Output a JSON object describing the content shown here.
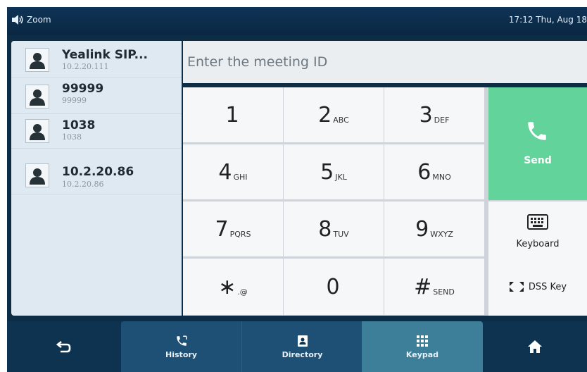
{
  "status_bar": {
    "mode_label": "Zoom",
    "datetime": "17:12 Thu, Aug 18"
  },
  "contacts": [
    {
      "name": "Yealink SIP...",
      "number": "10.2.20.111"
    },
    {
      "name": "99999",
      "number": "99999"
    },
    {
      "name": "1038",
      "number": "1038"
    },
    {
      "name": "10.2.20.86",
      "number": "10.2.20.86"
    }
  ],
  "meeting_input": {
    "placeholder": "Enter the meeting ID",
    "value": ""
  },
  "keypad": [
    {
      "digit": "1",
      "sub": ""
    },
    {
      "digit": "2",
      "sub": "ABC"
    },
    {
      "digit": "3",
      "sub": "DEF"
    },
    {
      "digit": "4",
      "sub": "GHI"
    },
    {
      "digit": "5",
      "sub": "JKL"
    },
    {
      "digit": "6",
      "sub": "MNO"
    },
    {
      "digit": "7",
      "sub": "PQRS"
    },
    {
      "digit": "8",
      "sub": "TUV"
    },
    {
      "digit": "9",
      "sub": "WXYZ"
    },
    {
      "digit": "∗",
      "sub": ".@"
    },
    {
      "digit": "0",
      "sub": ""
    },
    {
      "digit": "#",
      "sub": "SEND"
    }
  ],
  "actions": {
    "send_label": "Send",
    "keyboard_label": "Keyboard",
    "dss_label": "DSS Key"
  },
  "nav": {
    "history_label": "History",
    "directory_label": "Directory",
    "keypad_label": "Keypad"
  },
  "colors": {
    "send_green": "#62d39a",
    "nav_dark": "#0e3351",
    "nav_active": "#3d7e98"
  },
  "icons": [
    "speaker-icon",
    "contact-avatar-icon",
    "phone-icon",
    "keyboard-icon",
    "dss-key-icon",
    "back-icon",
    "history-icon",
    "directory-icon",
    "keypad-icon",
    "home-icon"
  ]
}
